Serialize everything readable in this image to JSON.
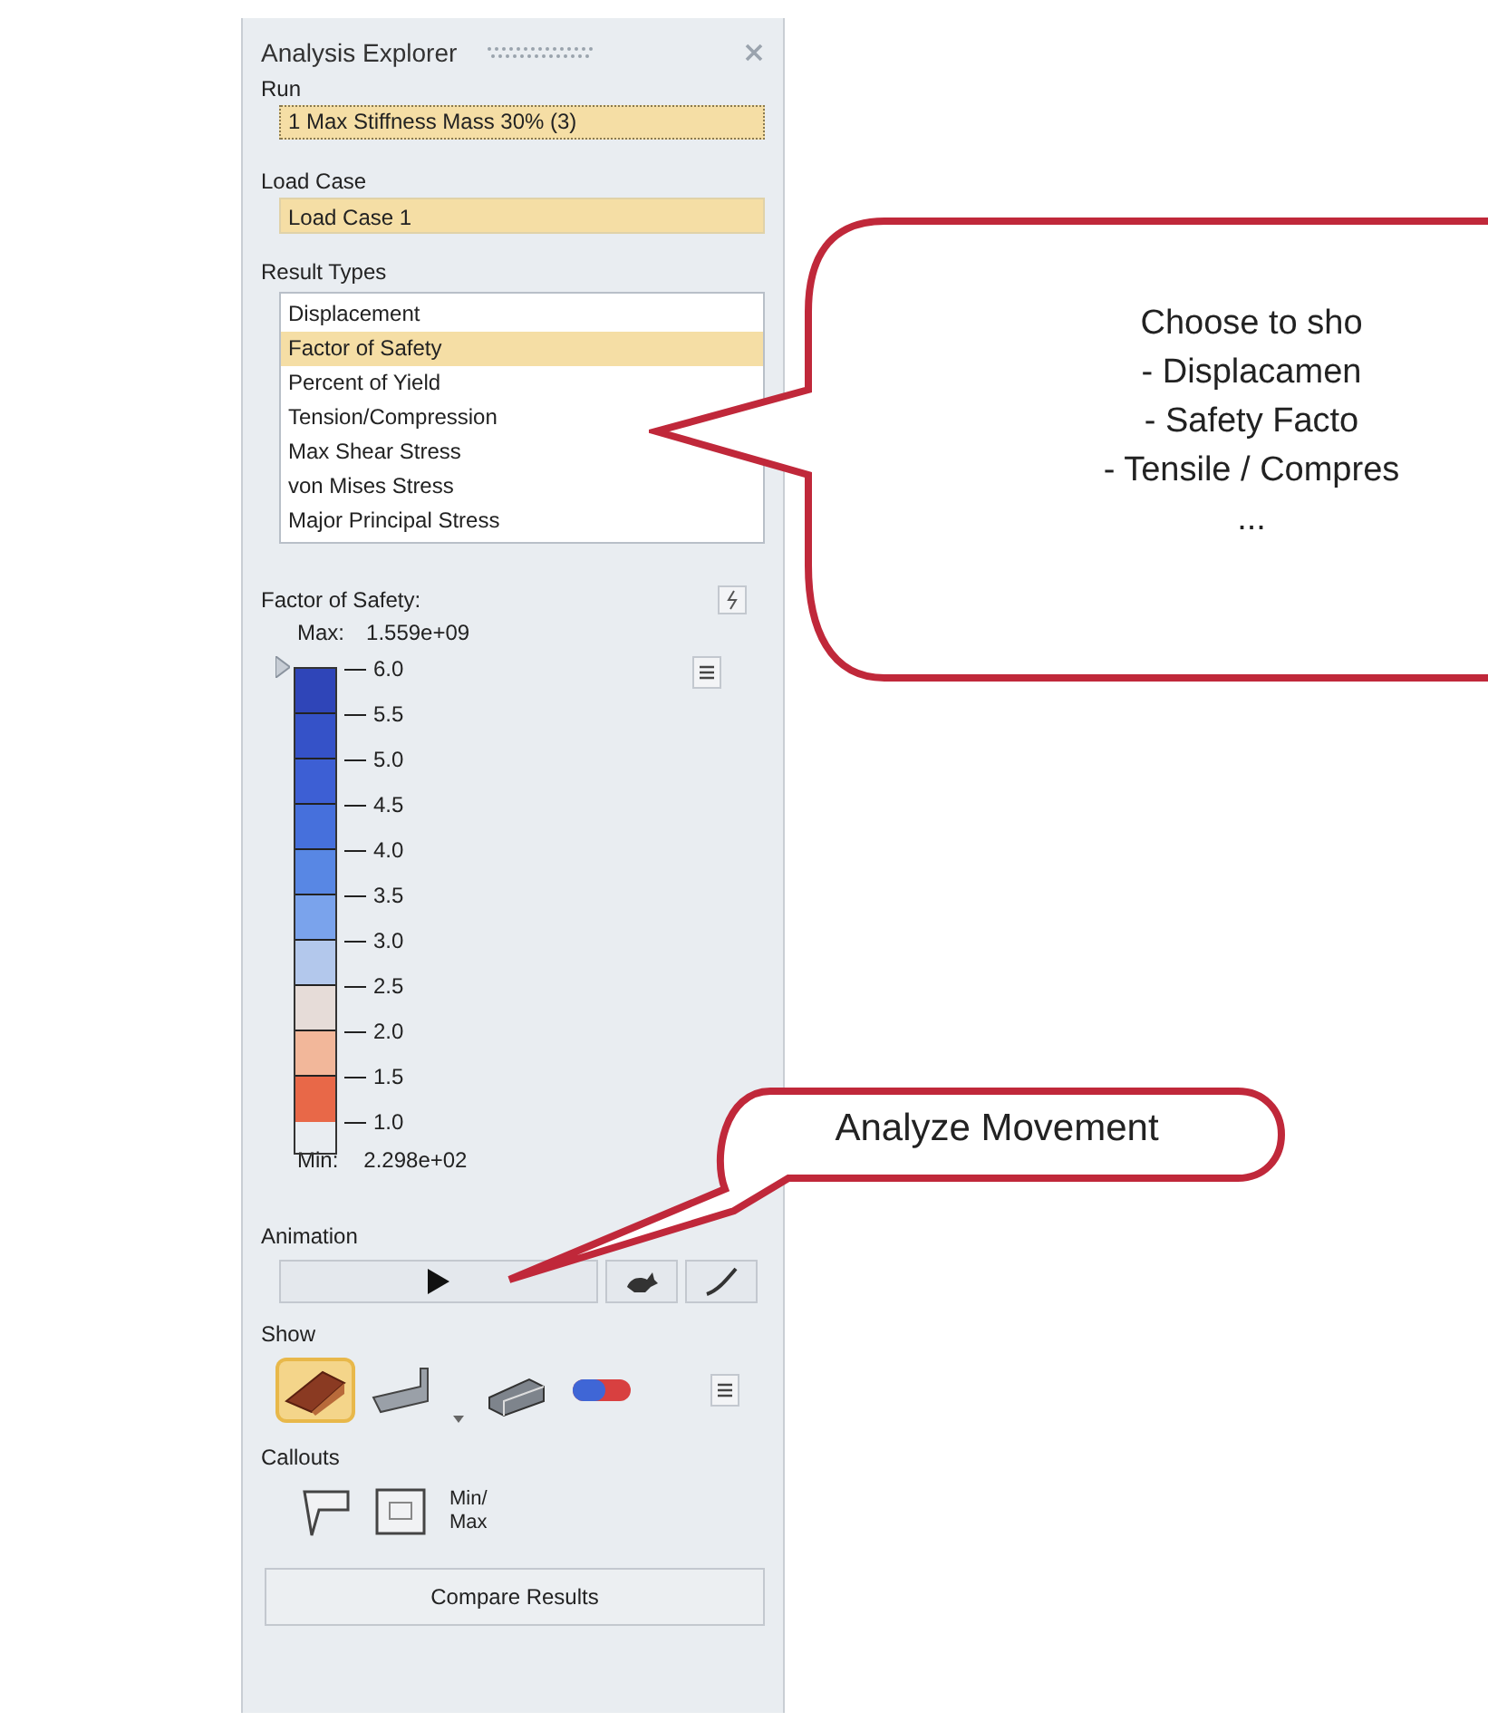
{
  "panel": {
    "title": "Analysis Explorer",
    "run": {
      "label": "Run",
      "value": "1 Max Stiffness Mass 30%  (3)"
    },
    "load_case": {
      "label": "Load Case",
      "value": "Load Case 1"
    },
    "result_types": {
      "label": "Result Types",
      "items": [
        {
          "label": "Displacement",
          "selected": false
        },
        {
          "label": "Factor of Safety",
          "selected": true
        },
        {
          "label": "Percent of Yield",
          "selected": false
        },
        {
          "label": "Tension/Compression",
          "selected": false
        },
        {
          "label": "Max Shear Stress",
          "selected": false
        },
        {
          "label": "von Mises Stress",
          "selected": false
        },
        {
          "label": "Major Principal Stress",
          "selected": false
        }
      ]
    },
    "legend": {
      "title": "Factor of Safety:",
      "max_label": "Max:",
      "max_value": "1.559e+09",
      "min_label": "Min:",
      "min_value": "2.298e+02",
      "ticks": [
        "6.0",
        "5.5",
        "5.0",
        "4.5",
        "4.0",
        "3.5",
        "3.0",
        "2.5",
        "2.0",
        "1.5",
        "1.0"
      ],
      "bands": [
        {
          "color": "#2f45b8"
        },
        {
          "color": "#3552c8"
        },
        {
          "color": "#3d5fd4"
        },
        {
          "color": "#4670dc"
        },
        {
          "color": "#5887e4"
        },
        {
          "color": "#7aa3ec"
        },
        {
          "color": "#b3c8ec"
        },
        {
          "color": "#e6dcd8"
        },
        {
          "color": "#f2b79a"
        },
        {
          "color": "#e86848"
        }
      ]
    },
    "animation": {
      "label": "Animation"
    },
    "show": {
      "label": "Show",
      "items": [
        {
          "kind": "shaded",
          "selected": true
        },
        {
          "kind": "outline",
          "selected": false
        },
        {
          "kind": "mesh",
          "selected": false
        },
        {
          "kind": "magnet",
          "selected": false
        }
      ]
    },
    "callouts": {
      "label": "Callouts",
      "min_max": "Min/\nMax"
    },
    "compare_button": "Compare Results"
  },
  "annotations": [
    {
      "kind": "bubble",
      "lines": [
        "Choose to sho",
        "- Displacamen",
        "- Safety Facto",
        "- Tensile / Compres",
        "..."
      ]
    },
    {
      "kind": "pill",
      "lines": [
        "Analyze Movement"
      ]
    }
  ]
}
